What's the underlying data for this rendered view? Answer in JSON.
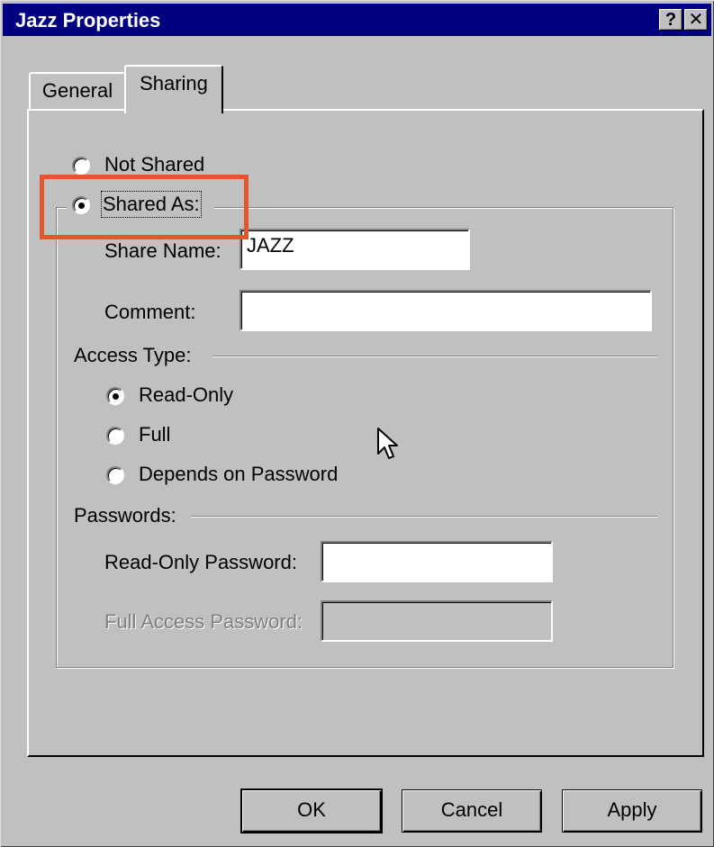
{
  "window": {
    "title": "Jazz Properties",
    "help_glyph": "?",
    "close_glyph": "✕"
  },
  "tabs": [
    {
      "label": "General",
      "selected": false
    },
    {
      "label": "Sharing",
      "selected": true
    }
  ],
  "sharing": {
    "not_shared_label": "Not Shared",
    "not_shared_selected": false,
    "shared_as_label": "Shared As:",
    "shared_as_selected": true,
    "share_name_label": "Share Name:",
    "share_name_value": "JAZZ",
    "comment_label": "Comment:",
    "comment_value": "",
    "access_type_label": "Access Type:",
    "access_options": [
      {
        "label": "Read-Only",
        "selected": true
      },
      {
        "label": "Full",
        "selected": false
      },
      {
        "label": "Depends on Password",
        "selected": false
      }
    ],
    "passwords_label": "Passwords:",
    "read_only_password_label": "Read-Only Password:",
    "read_only_password_value": "",
    "full_access_password_label": "Full Access Password:",
    "full_access_password_value": "",
    "full_access_password_enabled": false
  },
  "buttons": {
    "ok": "OK",
    "cancel": "Cancel",
    "apply": "Apply"
  },
  "colors": {
    "titlebar": "#000080",
    "face": "#c0c0c0",
    "highlight": "#e0562d"
  }
}
